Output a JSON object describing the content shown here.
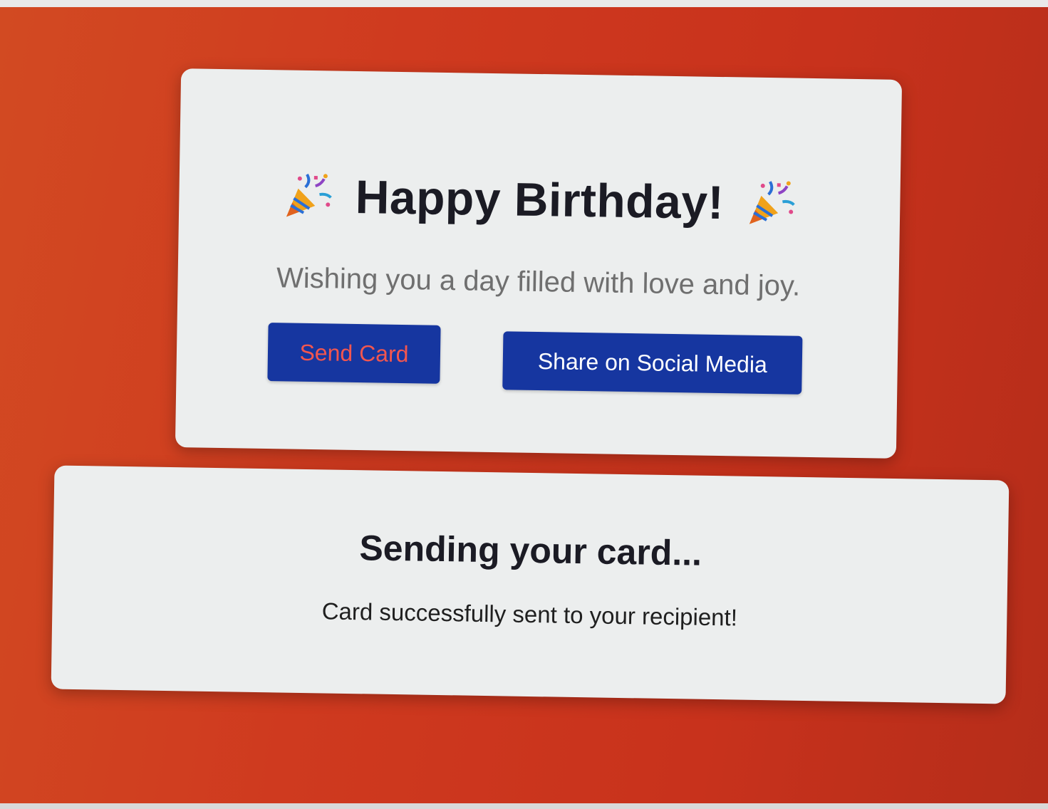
{
  "card": {
    "title": "Happy Birthday!",
    "title_icon": "party-popper-icon",
    "subtitle": "Wishing you a day filled with love and joy."
  },
  "actions": {
    "send_label": "Send Card",
    "share_label": "Share on Social Media"
  },
  "status": {
    "title": "Sending your card...",
    "message": "Card successfully sent to your recipient!"
  },
  "colors": {
    "background": "#cf3a1f",
    "panel": "#eceeee",
    "button": "#1636a0",
    "send_label": "#f2564f",
    "share_label": "#ffffff",
    "title_text": "#1b1b24",
    "subtitle_text": "#6f6f6f"
  }
}
